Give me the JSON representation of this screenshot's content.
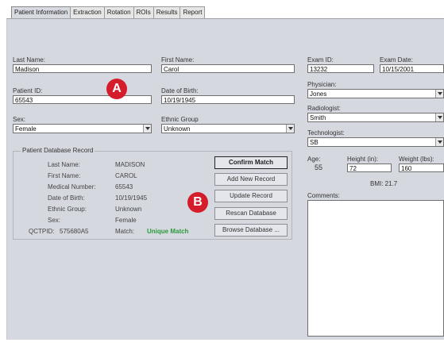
{
  "tabs": [
    "Patient Information",
    "Extraction",
    "Rotation",
    "ROIs",
    "Results",
    "Report"
  ],
  "patient": {
    "last_name_label": "Last Name:",
    "last_name": "Madison",
    "first_name_label": "First Name:",
    "first_name": "Carol",
    "patient_id_label": "Patient ID:",
    "patient_id": "65543",
    "dob_label": "Date of Birth:",
    "dob": "10/19/1945",
    "sex_label": "Sex:",
    "sex": "Female",
    "ethnic_label": "Ethnic Group",
    "ethnic": "Unknown"
  },
  "exam": {
    "exam_id_label": "Exam ID:",
    "exam_id": "13232",
    "exam_date_label": "Exam Date:",
    "exam_date": "10/15/2001",
    "physician_label": "Physician:",
    "physician": "Jones",
    "radiologist_label": "Radiologist:",
    "radiologist": "Smith",
    "technologist_label": "Technologist:",
    "technologist": "SB",
    "age_label": "Age:",
    "age": "55",
    "height_label": "Height (in):",
    "height": "72",
    "weight_label": "Weight (lbs):",
    "weight": "160",
    "bmi": "BMI: 21.7",
    "comments_label": "Comments:"
  },
  "record": {
    "title": "Patient Database Record",
    "last_name_label": "Last Name:",
    "last_name": "MADISON",
    "first_name_label": "First Name:",
    "first_name": "CAROL",
    "medical_number_label": "Medical Number:",
    "medical_number": "65543",
    "dob_label": "Date of Birth:",
    "dob": "10/19/1945",
    "ethnic_label": "Ethnic Group:",
    "ethnic": "Unknown",
    "sex_label": "Sex:",
    "sex": "Female",
    "qctpid_label": "QCTPID:",
    "qctpid": "575680A5",
    "match_label": "Match:",
    "match": "Unique Match"
  },
  "buttons": {
    "confirm": "Confirm Match",
    "add": "Add New Record",
    "update": "Update Record",
    "rescan": "Rescan Database",
    "browse": "Browse Database ..."
  },
  "markers": {
    "a": "A",
    "b": "B"
  },
  "colors": {
    "marker": "#d41c2a",
    "match": "#2a9a3a",
    "panel": "#d6d8e0"
  }
}
